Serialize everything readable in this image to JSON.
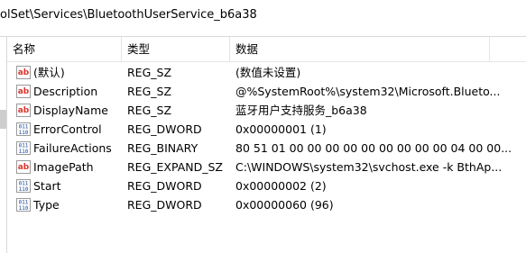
{
  "address": {
    "path": "olSet\\Services\\BluetoothUserService_b6a38"
  },
  "columns": {
    "name": "名称",
    "type": "类型",
    "data": "数据"
  },
  "rows": [
    {
      "icon": "string-value-icon",
      "name": "(默认)",
      "type": "REG_SZ",
      "data": "(数值未设置)"
    },
    {
      "icon": "string-value-icon",
      "name": "Description",
      "type": "REG_SZ",
      "data": "@%SystemRoot%\\system32\\Microsoft.Blueto..."
    },
    {
      "icon": "string-value-icon",
      "name": "DisplayName",
      "type": "REG_SZ",
      "data": "蓝牙用户支持服务_b6a38"
    },
    {
      "icon": "binary-value-icon",
      "name": "ErrorControl",
      "type": "REG_DWORD",
      "data": "0x00000001 (1)"
    },
    {
      "icon": "binary-value-icon",
      "name": "FailureActions",
      "type": "REG_BINARY",
      "data": "80 51 01 00 00 00 00 00 00 00 00 00 04 00 00..."
    },
    {
      "icon": "string-value-icon",
      "name": "ImagePath",
      "type": "REG_EXPAND_SZ",
      "data": "C:\\WINDOWS\\system32\\svchost.exe -k BthAp..."
    },
    {
      "icon": "binary-value-icon",
      "name": "Start",
      "type": "REG_DWORD",
      "data": "0x00000002 (2)"
    },
    {
      "icon": "binary-value-icon",
      "name": "Type",
      "type": "REG_DWORD",
      "data": "0x00000060 (96)"
    }
  ],
  "colors": {
    "string_icon": "#d9342b",
    "binary_icon_fill": "#5b7db8",
    "border": "#e5e5e5"
  }
}
